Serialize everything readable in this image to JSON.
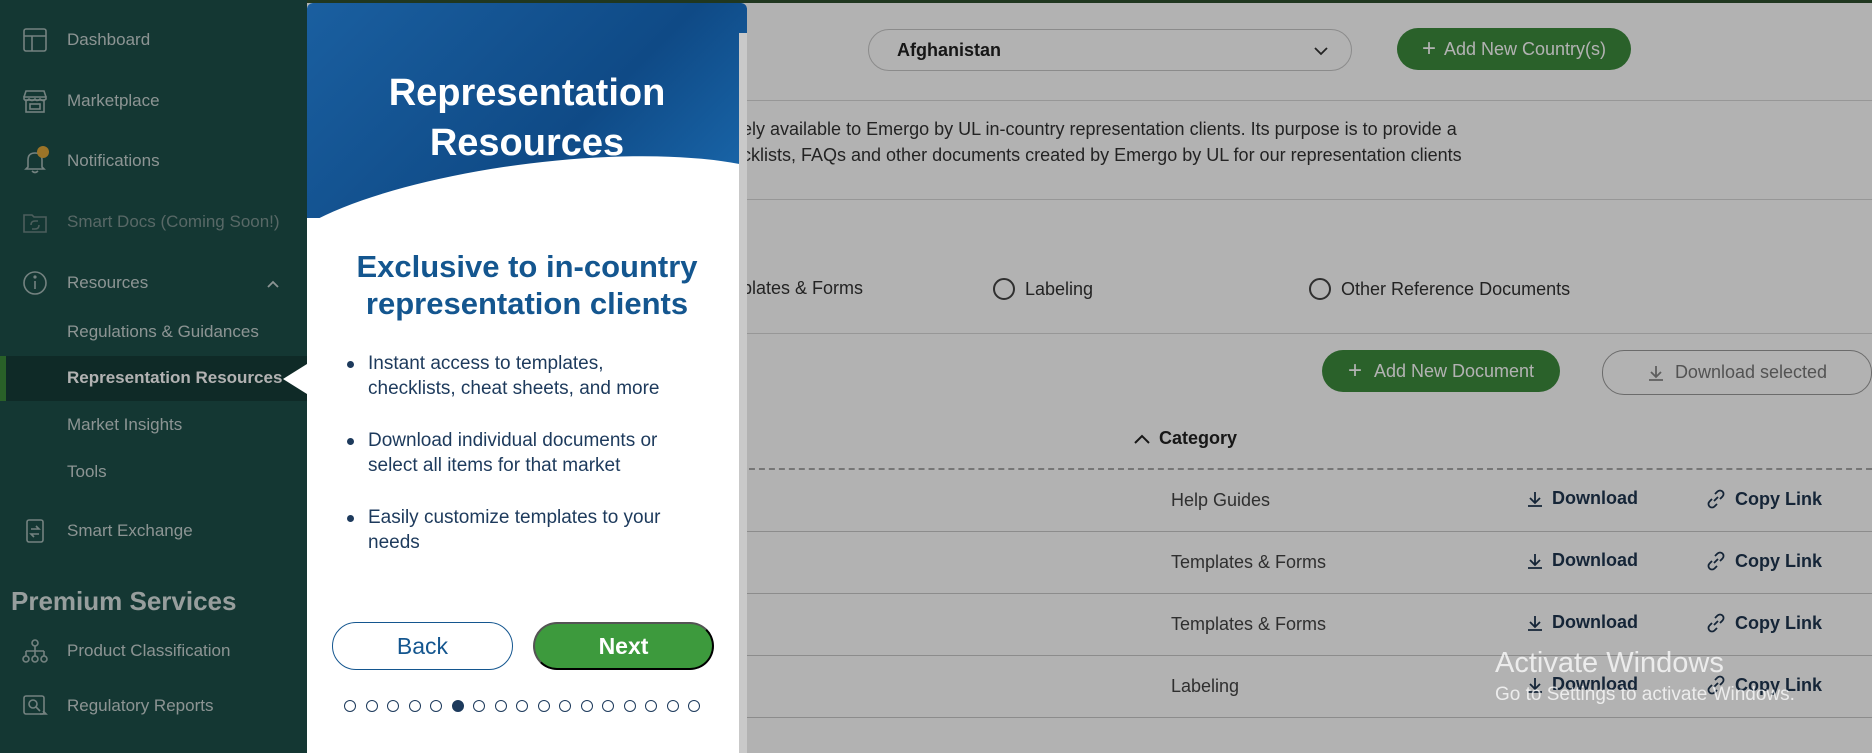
{
  "sidebar": {
    "items": [
      {
        "label": "Dashboard"
      },
      {
        "label": "Marketplace"
      },
      {
        "label": "Notifications"
      },
      {
        "label": "Smart Docs (Coming Soon!)"
      },
      {
        "label": "Resources"
      },
      {
        "label": "Smart Exchange"
      },
      {
        "label": "Product Classification"
      },
      {
        "label": "Regulatory Reports"
      }
    ],
    "subitems": [
      {
        "label": "Regulations & Guidances"
      },
      {
        "label": "Representation Resources"
      },
      {
        "label": "Market Insights"
      },
      {
        "label": "Tools"
      }
    ],
    "section_title": "Premium Services"
  },
  "main": {
    "country": "Afghanistan",
    "add_country_label": "Add New Country(s)",
    "intro_line1": "ely available to Emergo by UL in-country representation clients. Its purpose is to provide a",
    "intro_line2": "cklists, FAQs and other documents created by Emergo by UL for our representation clients",
    "filters": [
      {
        "label": "plates & Forms"
      },
      {
        "label": "Labeling"
      },
      {
        "label": "Other Reference Documents"
      }
    ],
    "add_document_label": "Add New Document",
    "download_selected_label": "Download selected",
    "category_header": "Category",
    "rows": [
      {
        "category": "Help Guides",
        "download": "Download",
        "copy": "Copy Link"
      },
      {
        "category": "Templates & Forms",
        "download": "Download",
        "copy": "Copy Link"
      },
      {
        "category": "Templates & Forms",
        "download": "Download",
        "copy": "Copy Link"
      },
      {
        "category": "Labeling",
        "download": "Download",
        "copy": "Copy Link"
      }
    ]
  },
  "modal": {
    "title_line1": "Representation",
    "title_line2": "Resources",
    "heading_line1": "Exclusive to in-country",
    "heading_line2": "representation clients",
    "bullets": [
      {
        "line1": "Instant access to templates,",
        "line2": "checklists, cheat sheets, and more"
      },
      {
        "line1": "Download individual documents or",
        "line2": "select all items for that market"
      },
      {
        "line1": "Easily customize templates to your",
        "line2": "needs"
      }
    ],
    "back_label": "Back",
    "next_label": "Next",
    "step_total": 17,
    "step_current": 6
  },
  "watermark": {
    "line1": "Activate Windows",
    "line2": "Go to Settings to activate Windows."
  }
}
